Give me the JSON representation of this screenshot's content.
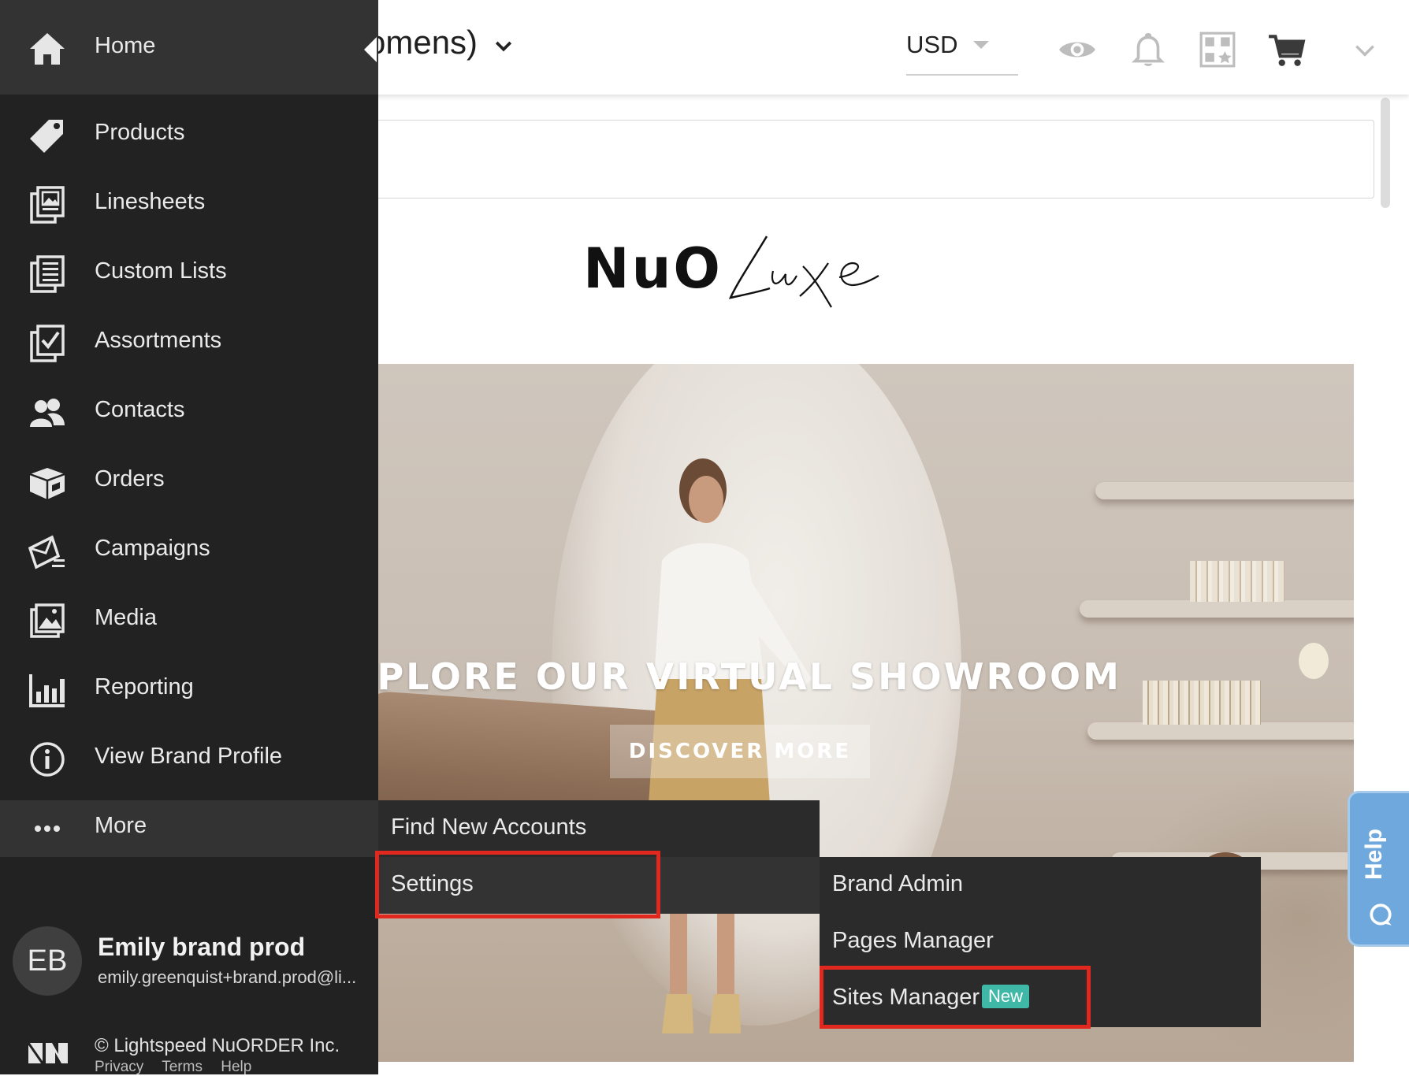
{
  "topbar": {
    "title_fragment": "omens)",
    "currency": "USD",
    "icons": [
      "chevron-down-icon",
      "caret-down-icon",
      "eye-icon",
      "bell-icon",
      "qr-code-icon",
      "cart-icon",
      "chevron-down-icon"
    ]
  },
  "sidebar": {
    "home": {
      "label": "Home",
      "icon": "home-icon"
    },
    "items": [
      {
        "label": "Products",
        "icon": "tag-icon"
      },
      {
        "label": "Linesheets",
        "icon": "linesheets-icon"
      },
      {
        "label": "Custom Lists",
        "icon": "list-icon"
      },
      {
        "label": "Assortments",
        "icon": "checklist-icon"
      },
      {
        "label": "Contacts",
        "icon": "users-icon"
      },
      {
        "label": "Orders",
        "icon": "box-icon"
      },
      {
        "label": "Campaigns",
        "icon": "campaign-icon"
      },
      {
        "label": "Media",
        "icon": "image-icon"
      },
      {
        "label": "Reporting",
        "icon": "bar-chart-icon"
      },
      {
        "label": "View Brand Profile",
        "icon": "info-icon"
      }
    ],
    "more": {
      "label": "More",
      "icon": "more-dots-icon"
    },
    "user": {
      "initials": "EB",
      "name": "Emily brand prod",
      "email": "emily.greenquist+brand.prod@li..."
    },
    "footer": {
      "copyright": "© Lightspeed NuORDER Inc.",
      "links": [
        "Privacy",
        "Terms",
        "Help"
      ]
    }
  },
  "flyout_more": {
    "items": [
      "Find New Accounts",
      "Settings"
    ]
  },
  "flyout_settings": {
    "items": [
      "Brand Admin",
      "Pages Manager",
      "Sites Manager"
    ],
    "badge": "New"
  },
  "content": {
    "logo_text": "NuO",
    "logo_script": "Luxe",
    "hero_heading": "XPLORE OUR VIRTUAL SHOWROOM",
    "hero_cta": "DISCOVER MORE"
  },
  "help": {
    "label": "Help"
  },
  "colors": {
    "sidebar_bg": "#222222",
    "sidebar_active_bg": "#333333",
    "highlight_red": "#e0281e",
    "badge_teal": "#3fb8a8",
    "help_blue": "#6fa8dc"
  }
}
